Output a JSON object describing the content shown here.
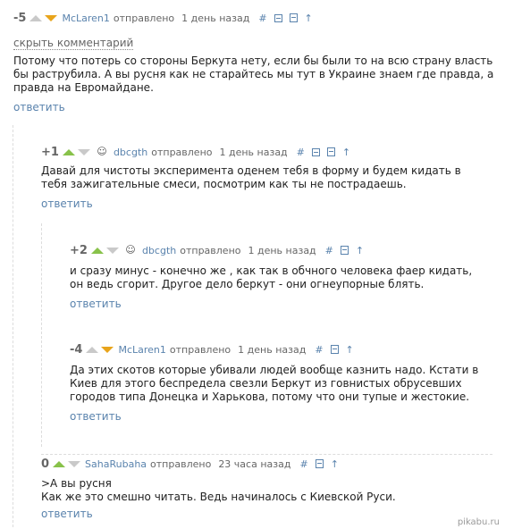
{
  "comments": [
    {
      "rating": "-5",
      "author": "McLaren1",
      "posted": "отправлено",
      "time": "1 день назад",
      "hide_label": "скрыть комментарий",
      "text": "Потому что потерь со стороны Беркута нету, если бы были то на всю страну власть бы раструбила. А вы русня как не старайтесь мы тут в Украине знаем где правда, а правда на Евромайдане.",
      "reply": "ответить"
    },
    {
      "rating": "+1",
      "author": "dbcgth",
      "posted": "отправлено",
      "time": "1 день назад",
      "text": "Давай для чистоты эксперимента оденем тебя в форму и будем кидать в тебя зажигательные смеси, посмотрим как ты не пострадаешь.",
      "reply": "ответить"
    },
    {
      "rating": "+2",
      "author": "dbcgth",
      "posted": "отправлено",
      "time": "1 день назад",
      "text": "и сразу минус - конечно же , как так в обчного человека фаер кидать, он ведь сгорит. Другое дело беркут - они огнеупорные блять.",
      "reply": "ответить"
    },
    {
      "rating": "-4",
      "author": "McLaren1",
      "posted": "отправлено",
      "time": "1 день назад",
      "text": "Да этих скотов которые убивали людей вообще казнить надо. Кстати в Киев для этого беспредела свезли Беркут из говнистых обрусевших городов типа Донецка и Харькова, потому что они тупые и жестокие.",
      "reply": "ответить"
    },
    {
      "rating": "0",
      "author": "SahaRubaha",
      "posted": "отправлено",
      "time": "23 часа назад",
      "text_line1": ">А вы русня",
      "text_line2": "Как же это смешно читать. Ведь начиналось с Киевской Руси.",
      "reply": "ответить"
    }
  ],
  "icons": {
    "hash": "#",
    "up_link": "↑",
    "avatar": "☺"
  },
  "watermark": "pikabu.ru",
  "colors": {
    "link": "#5a83ad",
    "upvote": "#88c24a",
    "downvote": "#e8a41b",
    "neutral": "#c9c9c9"
  }
}
